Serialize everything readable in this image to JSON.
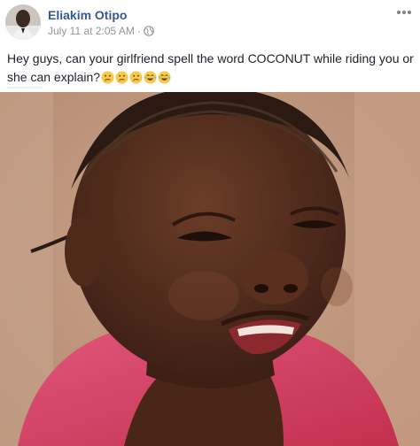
{
  "post": {
    "author": "Eliakim Otipo",
    "timestamp": "July 11 at 2:05 AM",
    "separator": "·",
    "privacy_icon": "globe-icon",
    "text": "Hey guys, can your girlfriend spell the word COCONUT while riding you or she can explain?",
    "emojis": [
      "thinking-face-icon",
      "thinking-face-icon",
      "thinking-face-icon",
      "tears-of-joy-icon",
      "tears-of-joy-icon"
    ],
    "more_icon": "more-options-icon",
    "photo_subject": "child-grimace-photo"
  },
  "colors": {
    "author_link": "#365899",
    "meta_text": "#90949c",
    "body_text": "#1d2129"
  }
}
